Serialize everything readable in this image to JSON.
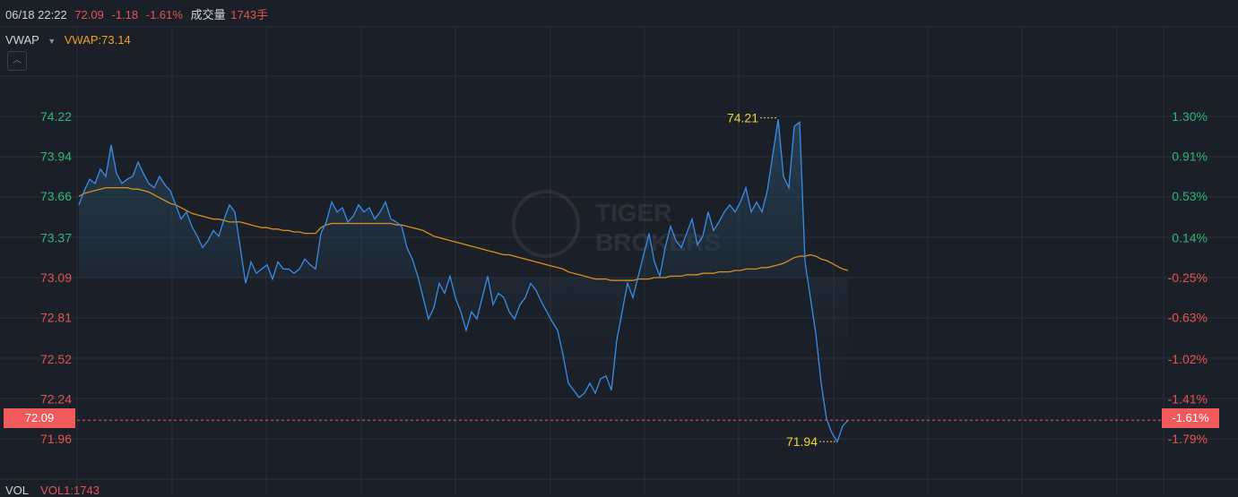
{
  "header": {
    "datetime": "06/18 22:22",
    "price": "72.09",
    "change": "-1.18",
    "change_pct": "-1.61%",
    "volume_label": "成交量",
    "volume_value": "1743手"
  },
  "indicator": {
    "name": "VWAP",
    "dropdown_icon": "caret-down-icon",
    "value_label": "VWAP:73.14"
  },
  "collapse_button": {
    "icon": "chevron-up-icon"
  },
  "watermark": {
    "line1": "TIGER",
    "line2": "BROKERS"
  },
  "volume_panel": {
    "name": "VOL",
    "value_label": "VOL1:1743"
  },
  "current_price_tag": {
    "left": "72.09",
    "right": "-1.61%"
  },
  "colors": {
    "background": "#1b1f27",
    "grid": "#2b303a",
    "price_line": "#3a8ee6",
    "vwap_line": "#d7901f",
    "up_text": "#2fb67c",
    "down_text": "#e25451",
    "marker_text": "#f0d23a"
  },
  "chart_data": {
    "type": "line",
    "title": "",
    "xlabel": "",
    "ylabel": "",
    "ylim": [
      71.96,
      74.22
    ],
    "left_ticks": [
      "74.22",
      "73.94",
      "73.66",
      "73.37",
      "73.09",
      "72.81",
      "72.52",
      "72.24",
      "71.96"
    ],
    "right_ticks": [
      "1.30%",
      "0.91%",
      "0.53%",
      "0.14%",
      "-0.25%",
      "-0.63%",
      "-1.02%",
      "-1.41%",
      "-1.79%"
    ],
    "grid": true,
    "annotations": [
      {
        "label": "74.21",
        "value": 74.21,
        "kind": "max"
      },
      {
        "label": "71.94",
        "value": 71.94,
        "kind": "min"
      }
    ],
    "series": [
      {
        "key": "price",
        "values": [
          73.6,
          73.7,
          73.78,
          73.75,
          73.85,
          73.8,
          74.02,
          73.82,
          73.75,
          73.78,
          73.8,
          73.9,
          73.82,
          73.75,
          73.72,
          73.8,
          73.74,
          73.7,
          73.6,
          73.5,
          73.55,
          73.45,
          73.38,
          73.3,
          73.35,
          73.42,
          73.38,
          73.5,
          73.6,
          73.55,
          73.3,
          73.05,
          73.2,
          73.12,
          73.15,
          73.18,
          73.08,
          73.2,
          73.15,
          73.15,
          73.12,
          73.15,
          73.22,
          73.18,
          73.15,
          73.4,
          73.48,
          73.62,
          73.55,
          73.58,
          73.48,
          73.52,
          73.6,
          73.55,
          73.58,
          73.5,
          73.55,
          73.62,
          73.5,
          73.48,
          73.45,
          73.3,
          73.22,
          73.1,
          72.95,
          72.8,
          72.88,
          73.05,
          72.98,
          73.1,
          72.95,
          72.85,
          72.72,
          72.85,
          72.8,
          72.95,
          73.1,
          72.9,
          72.98,
          72.95,
          72.85,
          72.8,
          72.9,
          72.95,
          73.05,
          73.0,
          72.92,
          72.85,
          72.78,
          72.72,
          72.55,
          72.35,
          72.3,
          72.25,
          72.28,
          72.35,
          72.28,
          72.38,
          72.4,
          72.3,
          72.65,
          72.85,
          73.05,
          72.95,
          73.1,
          73.25,
          73.4,
          73.2,
          73.1,
          73.3,
          73.45,
          73.35,
          73.3,
          73.4,
          73.5,
          73.32,
          73.38,
          73.55,
          73.42,
          73.48,
          73.55,
          73.6,
          73.55,
          73.62,
          73.72,
          73.55,
          73.62,
          73.55,
          73.7,
          73.95,
          74.2,
          73.8,
          73.72,
          74.15,
          74.18,
          73.2,
          72.95,
          72.7,
          72.35,
          72.1,
          72.0,
          71.94,
          72.05,
          72.09
        ]
      },
      {
        "key": "vwap",
        "values": [
          73.66,
          73.68,
          73.69,
          73.7,
          73.71,
          73.72,
          73.72,
          73.72,
          73.72,
          73.72,
          73.71,
          73.71,
          73.7,
          73.69,
          73.67,
          73.65,
          73.63,
          73.61,
          73.6,
          73.58,
          73.56,
          73.54,
          73.53,
          73.52,
          73.51,
          73.5,
          73.5,
          73.49,
          73.48,
          73.48,
          73.48,
          73.47,
          73.46,
          73.45,
          73.44,
          73.44,
          73.43,
          73.43,
          73.42,
          73.42,
          73.41,
          73.41,
          73.4,
          73.4,
          73.4,
          73.44,
          73.46,
          73.47,
          73.47,
          73.47,
          73.47,
          73.47,
          73.47,
          73.47,
          73.47,
          73.47,
          73.47,
          73.47,
          73.47,
          73.46,
          73.46,
          73.45,
          73.44,
          73.43,
          73.42,
          73.4,
          73.38,
          73.37,
          73.36,
          73.35,
          73.34,
          73.33,
          73.32,
          73.31,
          73.3,
          73.29,
          73.28,
          73.27,
          73.26,
          73.25,
          73.25,
          73.24,
          73.23,
          73.22,
          73.21,
          73.2,
          73.19,
          73.18,
          73.17,
          73.16,
          73.15,
          73.13,
          73.12,
          73.11,
          73.1,
          73.09,
          73.08,
          73.08,
          73.08,
          73.07,
          73.07,
          73.07,
          73.07,
          73.07,
          73.08,
          73.08,
          73.08,
          73.09,
          73.09,
          73.09,
          73.1,
          73.1,
          73.1,
          73.11,
          73.11,
          73.11,
          73.12,
          73.12,
          73.12,
          73.13,
          73.13,
          73.13,
          73.14,
          73.14,
          73.15,
          73.15,
          73.15,
          73.16,
          73.16,
          73.17,
          73.18,
          73.19,
          73.21,
          73.23,
          73.24,
          73.24,
          73.25,
          73.24,
          73.22,
          73.21,
          73.19,
          73.17,
          73.15,
          73.14
        ]
      }
    ]
  }
}
